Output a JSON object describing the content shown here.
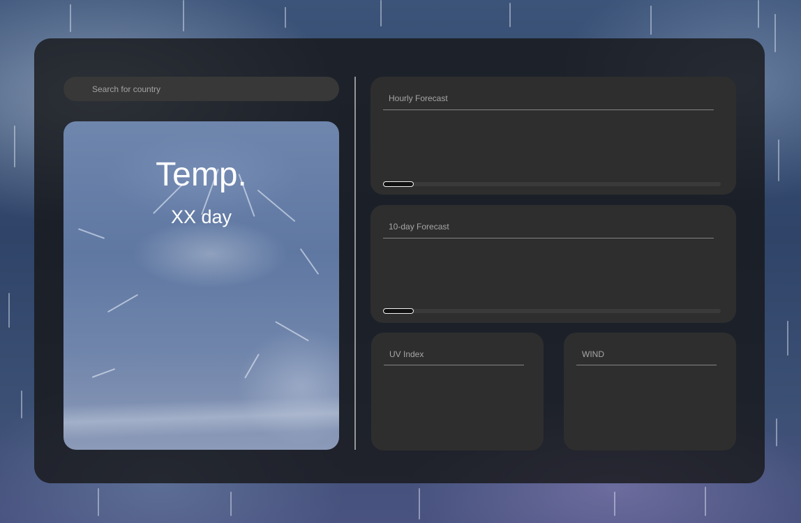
{
  "search": {
    "placeholder": "Search for country"
  },
  "hero": {
    "temperature": "Temp.",
    "day": "XX day"
  },
  "cards": {
    "hourly": {
      "title": "Hourly Forecast",
      "scroll_position": 0.0
    },
    "ten_day": {
      "title": "10-day Forecast",
      "scroll_position": 0.0
    },
    "uv": {
      "title": "UV Index"
    },
    "wind": {
      "title": "WIND"
    }
  },
  "colors": {
    "panel": "#1a1a1c",
    "card": "#2e2e2e",
    "search_bg": "#383838",
    "text_primary": "#ffffff",
    "text_secondary": "#a6a6a6"
  },
  "icons": {
    "background": "rain-background-image",
    "hero_image": "rain-splash-image"
  }
}
